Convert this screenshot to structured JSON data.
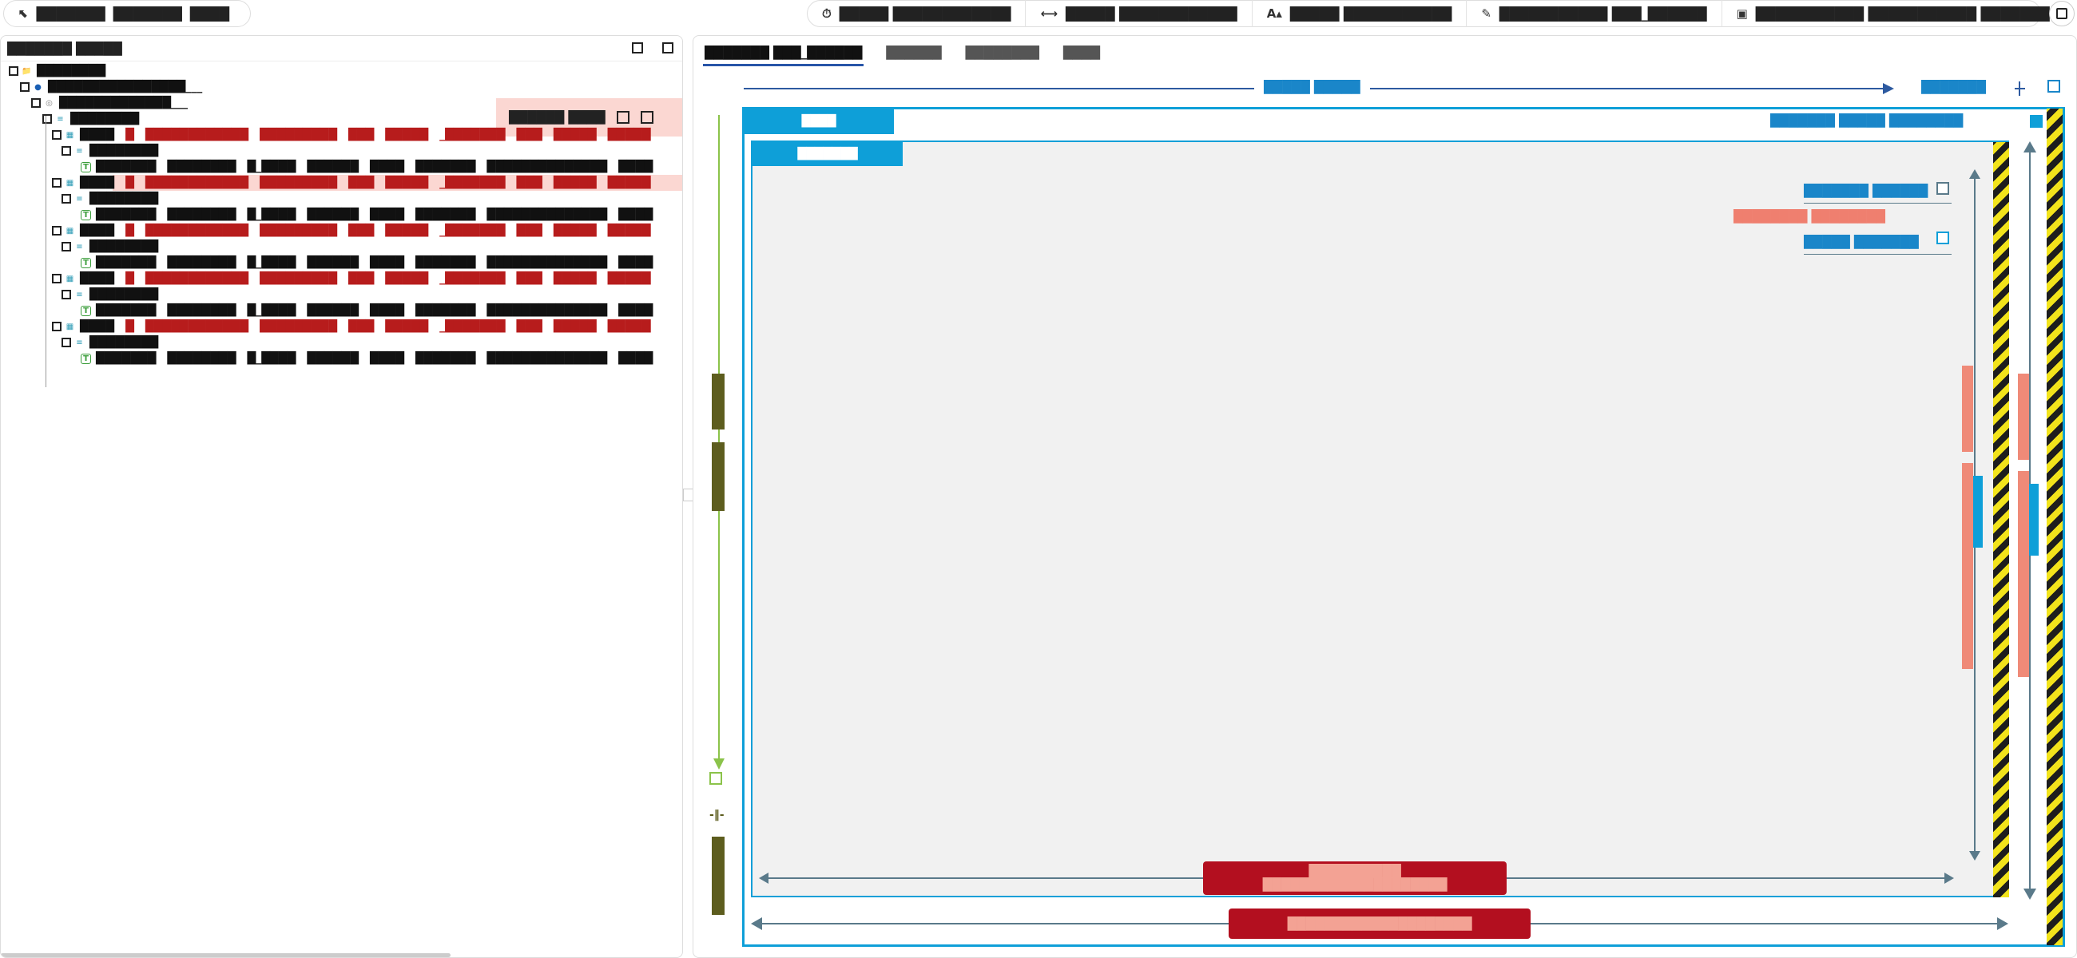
{
  "toolbar": {
    "left": {
      "label_a": "███████",
      "label_b": "███████",
      "label_c": "████"
    },
    "right": [
      {
        "icon": "⏱",
        "icon_name": "stopwatch-icon",
        "label": "█████  ████████████"
      },
      {
        "icon": "⟷",
        "icon_name": "width-icon",
        "label": "█████  ████████████"
      },
      {
        "icon": "A▴",
        "icon_name": "font-size-icon",
        "label": "█████  ███████████"
      },
      {
        "icon": "✎",
        "icon_name": "pen-icon",
        "label": "███████████  ███_██████"
      },
      {
        "icon": "▣",
        "icon_name": "image-icon",
        "label": "███████████  ███████████  ███████"
      }
    ]
  },
  "left_panel": {
    "title": "███████  █████",
    "highlight_text": "██████  ████",
    "tree": [
      {
        "level": 0,
        "icon": "folder",
        "label": "████████"
      },
      {
        "level": 1,
        "icon": "globe",
        "label": "████████████████___"
      },
      {
        "level": 2,
        "icon": "cloud",
        "label": "█████████████___"
      },
      {
        "level": 3,
        "icon": "list",
        "label": "████████"
      },
      {
        "level": 4,
        "icon": "table",
        "label": "████",
        "red": [
          "█",
          "████████████",
          "█████████",
          "███",
          "█████",
          "_███████",
          "███",
          "█████",
          "█████"
        ]
      },
      {
        "level": 5,
        "icon": "list",
        "label": "████████"
      },
      {
        "level": 6,
        "icon": "T",
        "tokens": [
          "███████",
          "████████",
          "█_████",
          "██████",
          "████",
          "███████",
          "██████████████",
          "████"
        ]
      },
      {
        "level": 4,
        "icon": "table",
        "label": "████",
        "red": [
          "█",
          "████████████",
          "█████████",
          "███",
          "█████",
          "_███████",
          "███",
          "█████",
          "█████"
        ],
        "dark": true
      },
      {
        "level": 5,
        "icon": "list",
        "label": "████████"
      },
      {
        "level": 6,
        "icon": "T",
        "tokens": [
          "███████",
          "████████",
          "█_████",
          "██████",
          "████",
          "███████",
          "██████████████",
          "████"
        ]
      },
      {
        "level": 4,
        "icon": "table",
        "label": "████",
        "red": [
          "█",
          "████████████",
          "█████████",
          "███",
          "█████",
          "_███████",
          "███",
          "█████",
          "█████"
        ]
      },
      {
        "level": 5,
        "icon": "list",
        "label": "████████"
      },
      {
        "level": 6,
        "icon": "T",
        "tokens": [
          "███████",
          "████████",
          "█_████",
          "██████",
          "████",
          "███████",
          "██████████████",
          "████"
        ]
      },
      {
        "level": 4,
        "icon": "table",
        "label": "████",
        "red": [
          "█",
          "████████████",
          "█████████",
          "███",
          "█████",
          "_███████",
          "███",
          "█████",
          "█████"
        ]
      },
      {
        "level": 5,
        "icon": "list",
        "label": "████████"
      },
      {
        "level": 6,
        "icon": "T",
        "tokens": [
          "███████",
          "████████",
          "█_████",
          "██████",
          "████",
          "███████",
          "██████████████",
          "████"
        ]
      },
      {
        "level": 4,
        "icon": "table",
        "label": "████",
        "red": [
          "█",
          "████████████",
          "█████████",
          "███",
          "█████",
          "_███████",
          "███",
          "█████",
          "█████"
        ]
      },
      {
        "level": 5,
        "icon": "list",
        "label": "████████"
      },
      {
        "level": 6,
        "icon": "T",
        "tokens": [
          "███████",
          "████████",
          "█_████",
          "██████",
          "████",
          "███████",
          "██████████████",
          "████"
        ]
      }
    ]
  },
  "right_panel": {
    "tabs": [
      "███████  ███_██████",
      "██████",
      "████████",
      "████"
    ],
    "top_arrow_label": "█████  █████",
    "top_right_label": "███████",
    "outer_tag": "████",
    "inner_tag": "███████",
    "outer_top_labels": "███████  █████  ████████",
    "inner_label_1": "███████  ██████",
    "inner_label_2": "████████  ████████",
    "inner_label_3": "█████  ███████",
    "badge_inner": "██████████\n████████████████████",
    "badge_outer": "████████████████████"
  },
  "colors": {
    "accent_blue": "#0e9fd8",
    "salmon": "#ef8a78",
    "dark_red": "#b30f1f",
    "olive": "#5d5d1e",
    "tab_underline": "#2855a8"
  }
}
